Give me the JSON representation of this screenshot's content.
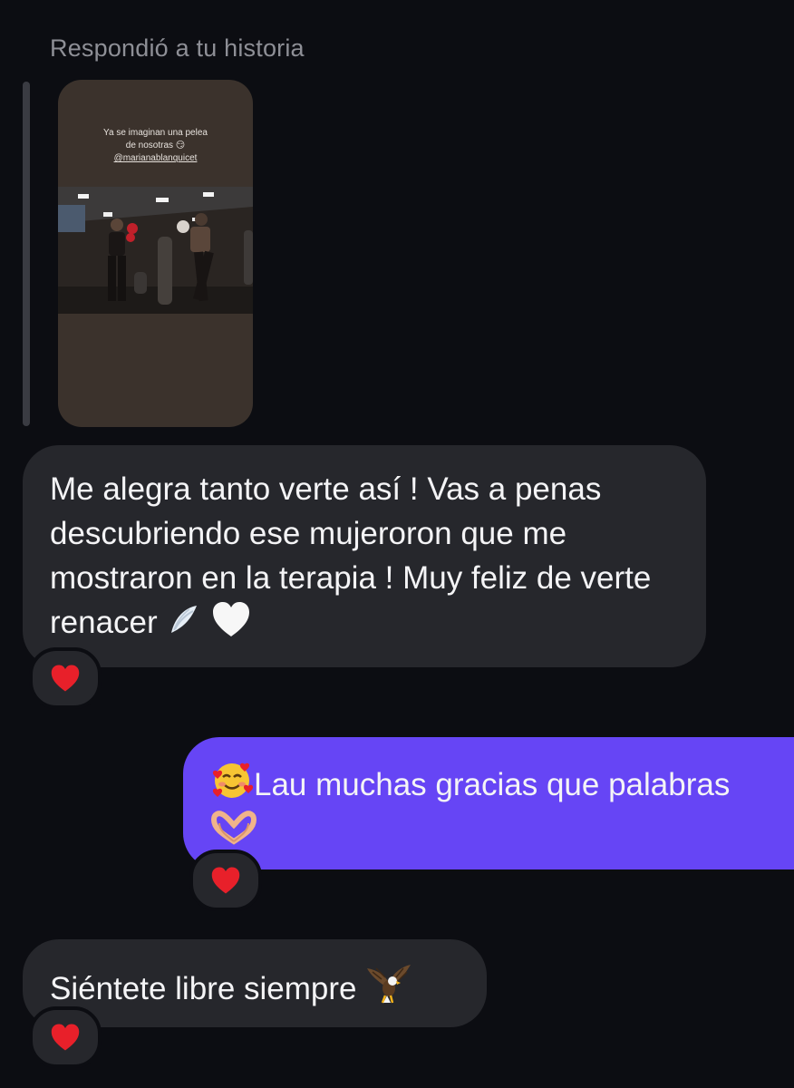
{
  "thread": {
    "reply_label": "Respondió a tu historia",
    "story": {
      "caption_line1": "Ya se imaginan una pelea",
      "caption_line2": "de nosotras 😏",
      "mention": "@marianablanquicet"
    }
  },
  "messages": [
    {
      "direction": "incoming",
      "text": "Me alegra tanto verte así ! Vas a penas descubriendo ese mujeroron que me mostraron en la terapia ! Muy feliz de verte renacer",
      "trailing_emoji": [
        "wing",
        "white-heart"
      ],
      "reaction": "red-heart"
    },
    {
      "direction": "outgoing",
      "leading_emoji": "smiling-face-with-hearts",
      "text": "Lau muchas gracias que palabras",
      "second_line_emoji": "heart-hands",
      "reaction": "red-heart"
    },
    {
      "direction": "incoming",
      "text": "Siéntete libre siempre",
      "trailing_emoji": "eagle",
      "reaction": "red-heart"
    }
  ],
  "colors": {
    "background": "#0c0d12",
    "incoming_bubble": "#26272c",
    "outgoing_bubble": "#6645f5",
    "reaction_heart": "#e8202a"
  }
}
